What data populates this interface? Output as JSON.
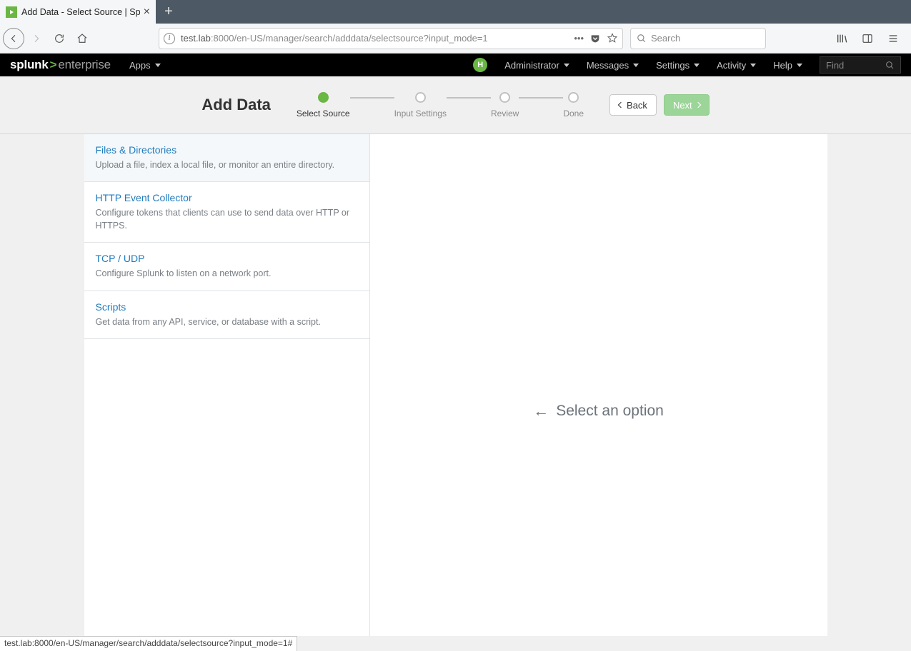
{
  "browser": {
    "tab_title": "Add Data - Select Source  |  Sp",
    "url_host_dim1": "test.lab",
    "url_host_dim2": ":8000/en-US/manager/search/adddata/selectsource?input_mode=1",
    "search_placeholder": "Search",
    "status_url": "test.lab:8000/en-US/manager/search/adddata/selectsource?input_mode=1#"
  },
  "nav": {
    "apps": "Apps",
    "avatar_initial": "H",
    "items": {
      "admin": "Administrator",
      "messages": "Messages",
      "settings": "Settings",
      "activity": "Activity",
      "help": "Help"
    },
    "find_placeholder": "Find"
  },
  "wizard": {
    "title": "Add Data",
    "steps": {
      "s1": "Select Source",
      "s2": "Input Settings",
      "s3": "Review",
      "s4": "Done"
    },
    "back": "Back",
    "next": "Next"
  },
  "sources": {
    "files": {
      "title": "Files & Directories",
      "desc": "Upload a file, index a local file, or monitor an entire directory."
    },
    "hec": {
      "title": "HTTP Event Collector",
      "desc": "Configure tokens that clients can use to send data over HTTP or HTTPS."
    },
    "tcpudp": {
      "title": "TCP / UDP",
      "desc": "Configure Splunk to listen on a network port."
    },
    "scripts": {
      "title": "Scripts",
      "desc": "Get data from any API, service, or database with a script."
    }
  },
  "detail": {
    "placeholder": "Select an option"
  }
}
